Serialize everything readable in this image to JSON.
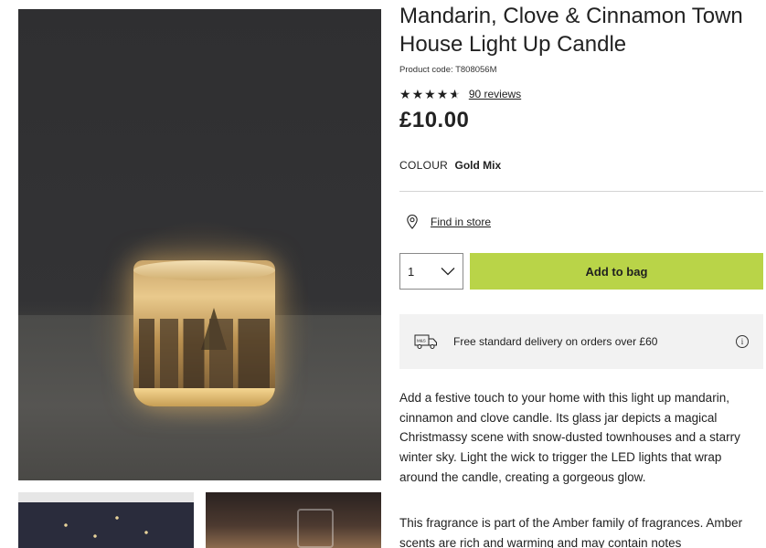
{
  "product": {
    "title": "Mandarin, Clove & Cinnamon Town House Light Up Candle",
    "code_label": "Product code: T808056M",
    "rating_value": 4.5,
    "reviews_link": "90 reviews",
    "price": "£10.00",
    "colour_label": "COLOUR",
    "colour_value": "Gold Mix"
  },
  "actions": {
    "find_in_store": "Find in store",
    "quantity": "1",
    "add_to_bag": "Add to bag"
  },
  "delivery": {
    "text": "Free standard delivery on orders over £60",
    "van_badge": "M&S"
  },
  "description": {
    "para1": "Add a festive touch to your home with this light up mandarin, cinnamon and clove candle. Its glass jar depicts a magical Christmassy scene with snow-dusted townhouses and a starry winter sky. Light the wick to trigger the LED lights that wrap around the candle, creating a gorgeous glow.",
    "para2": "This fragrance is part of the Amber family of fragrances. Amber scents are rich and warming and may contain notes"
  },
  "icons": {
    "star": "★",
    "info": "i"
  },
  "colors": {
    "accent_button": "#b9d448",
    "delivery_bg": "#f2f2f2"
  }
}
